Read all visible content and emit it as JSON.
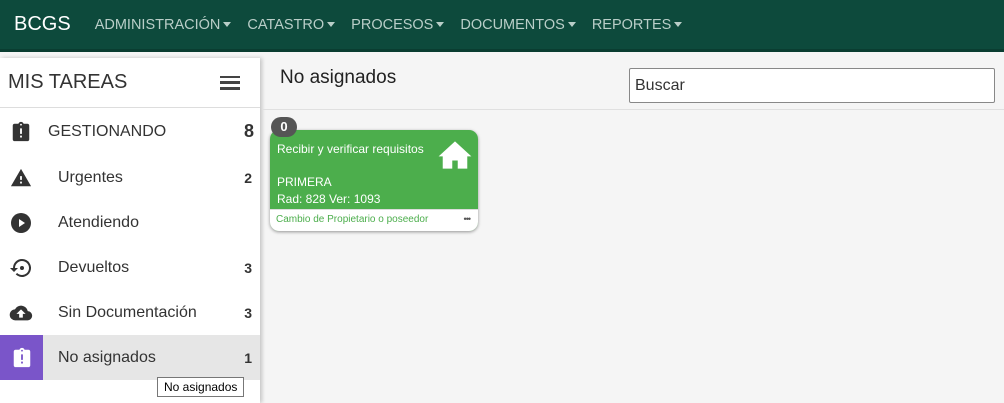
{
  "navbar": {
    "brand": "BCGS",
    "menus": [
      {
        "label": "ADMINISTRACIÓN"
      },
      {
        "label": "CATASTRO"
      },
      {
        "label": "PROCESOS"
      },
      {
        "label": "DOCUMENTOS"
      },
      {
        "label": "REPORTES"
      }
    ]
  },
  "sidebar": {
    "title": "MIS TAREAS",
    "main_item": {
      "label": "GESTIONANDO",
      "count": "8",
      "icon": "clipboard-alert-icon"
    },
    "items": [
      {
        "label": "Urgentes",
        "count": "2",
        "icon": "warning-icon"
      },
      {
        "label": "Atendiendo",
        "count": "",
        "icon": "play-circle-icon"
      },
      {
        "label": "Devueltos",
        "count": "3",
        "icon": "history-icon"
      },
      {
        "label": "Sin Documentación",
        "count": "3",
        "icon": "cloud-upload-icon"
      },
      {
        "label": "No asignados",
        "count": "1",
        "icon": "clipboard-alert-icon"
      }
    ],
    "tooltip": "No asignados"
  },
  "main": {
    "title": "No asignados",
    "search_placeholder": "Buscar",
    "card": {
      "badge": "0",
      "title": "Recibir y verificar requisitos",
      "line1": "PRIMERA",
      "line2": "Rad: 828 Ver: 1093",
      "footer": "Cambio de Propietario o poseedor",
      "more": "•••",
      "icon": "home-icon"
    }
  },
  "colors": {
    "navbar": "#0d4a3c",
    "card": "#4cae4c",
    "active": "#7a55c9"
  }
}
